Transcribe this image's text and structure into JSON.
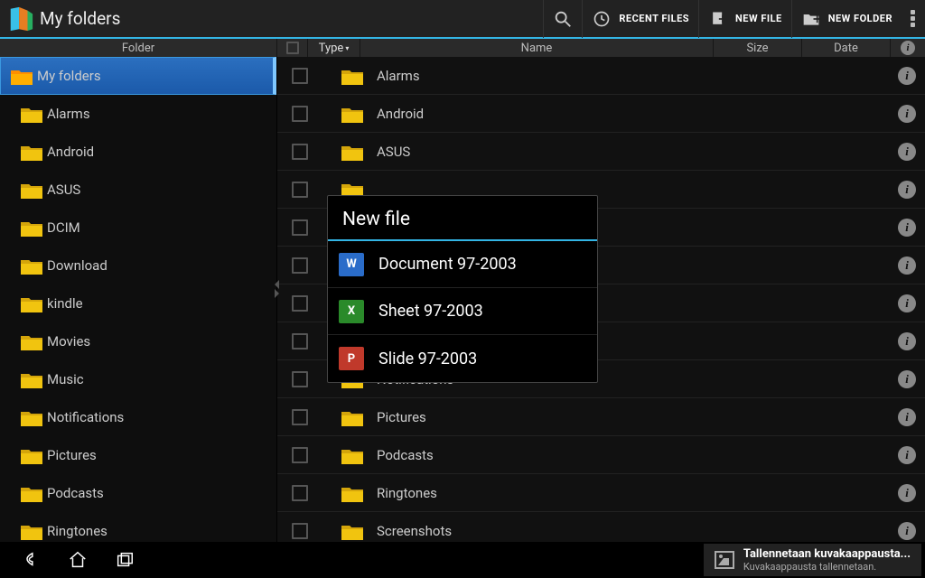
{
  "header": {
    "title": "My folders",
    "search_icon": "search-icon",
    "recent_label": "RECENT FILES",
    "newfile_label": "NEW FILE",
    "newfolder_label": "NEW FOLDER"
  },
  "columnHeaders": {
    "folder": "Folder",
    "type": "Type",
    "name": "Name",
    "size": "Size",
    "date": "Date"
  },
  "sidebar": {
    "root": "My folders",
    "items": [
      "Alarms",
      "Android",
      "ASUS",
      "DCIM",
      "Download",
      "kindle",
      "Movies",
      "Music",
      "Notifications",
      "Pictures",
      "Podcasts",
      "Ringtones"
    ]
  },
  "files": {
    "items": [
      "Alarms",
      "Android",
      "ASUS",
      "",
      "",
      "",
      "",
      "",
      "Notifications",
      "Pictures",
      "Podcasts",
      "Ringtones",
      "Screenshots"
    ]
  },
  "dialog": {
    "title": "New file",
    "items": [
      {
        "type": "doc",
        "glyph": "W",
        "label": "Document 97-2003"
      },
      {
        "type": "sheet",
        "glyph": "X",
        "label": "Sheet 97-2003"
      },
      {
        "type": "slide",
        "glyph": "P",
        "label": "Slide 97-2003"
      }
    ]
  },
  "toast": {
    "title": "Tallennetaan kuvakaappausta...",
    "subtitle": "Kuvakaappausta tallennetaan."
  }
}
